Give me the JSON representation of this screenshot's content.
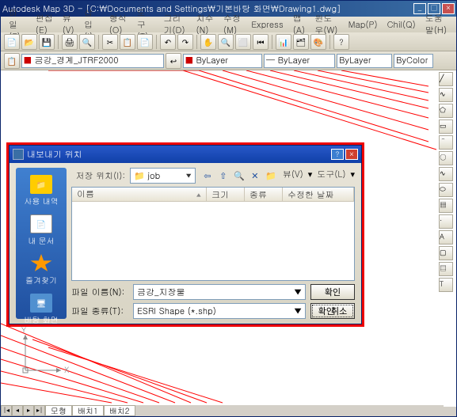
{
  "window": {
    "title": "Autodesk Map 3D - [C:\\Documents and Settings\\기본바탕 화면\\Drawing1.dwg]"
  },
  "menu": {
    "items": [
      "파일(F)",
      "편집(E)",
      "뷰(V)",
      "삽입(I)",
      "형식(O)",
      "도구(T)",
      "그리기(D)",
      "치수(N)",
      "수정(M)",
      "Express",
      "맵(A)",
      "윈도우(W)",
      "Map(P)",
      "Chil(Q)",
      "도움말(H)"
    ]
  },
  "layerbar": {
    "layer_name": "금강_경계_JTRF2000",
    "bylayer1": "ByLayer",
    "bylayer2": "ByLayer",
    "bycolor": "ByColor"
  },
  "tabs": {
    "model": "모형",
    "layout1": "배치1",
    "layout2": "배치2"
  },
  "ucs": {
    "x": "X",
    "y": "Y"
  },
  "dialog": {
    "title": "내보내기 위치",
    "save_location_label": "저장 위치(I):",
    "current_folder": "job",
    "view_menu": "뷰(V)",
    "tools_menu": "도구(L)",
    "sidebar": [
      {
        "label": "사용 내역"
      },
      {
        "label": "내 문서"
      },
      {
        "label": "즐겨찾기"
      },
      {
        "label": "바탕 화면"
      }
    ],
    "columns": {
      "name": "이름",
      "size": "크기",
      "type": "종류",
      "date": "수정한 날짜"
    },
    "filename_label": "파일 이름(N):",
    "filename_value": "금강_지장물",
    "filetype_label": "파일 종류(T):",
    "filetype_value": "ESRI Shape (*.shp)",
    "ok_button": "확인",
    "cancel_button": "취소",
    "confirm_button": "확인"
  }
}
